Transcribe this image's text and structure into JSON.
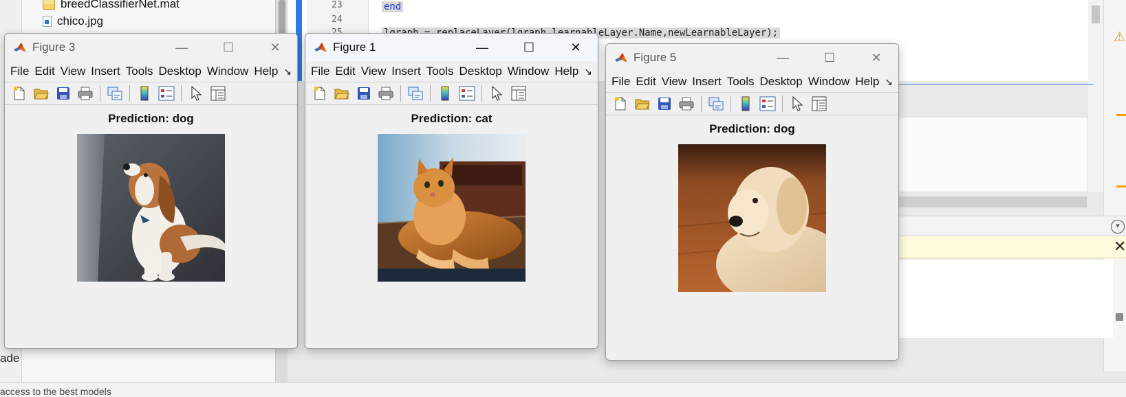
{
  "background": {
    "files": [
      {
        "name": "breedClassifierNet.mat",
        "icon": "mat-file-icon"
      },
      {
        "name": "chico.jpg",
        "icon": "jpg-file-icon"
      }
    ],
    "editor": {
      "line_numbers": [
        "23",
        "24",
        "25"
      ],
      "line23": "end",
      "line25": "lgraph = replaceLayer(lgraph,learnableLayer.Name,newLearnableLayer);"
    },
    "bottom_left_text": "access to the best models",
    "left_clip_text": "ade"
  },
  "figures": [
    {
      "id": "figure3",
      "title": "Figure 3",
      "active": false,
      "plot_title": "Prediction: dog",
      "image_subject": "beagle puppy sitting"
    },
    {
      "id": "figure1",
      "title": "Figure 1",
      "active": true,
      "plot_title": "Prediction: cat",
      "image_subject": "orange tabby cat lying on table"
    },
    {
      "id": "figure5",
      "title": "Figure 5",
      "active": false,
      "plot_title": "Prediction: dog",
      "image_subject": "golden retriever on wooden floor"
    }
  ],
  "menu": [
    "File",
    "Edit",
    "View",
    "Insert",
    "Tools",
    "Desktop",
    "Window",
    "Help"
  ],
  "colors": {
    "editor_accent": "#2e7be0",
    "keyword": "#1c3fd6",
    "warning": "#e8a100"
  }
}
